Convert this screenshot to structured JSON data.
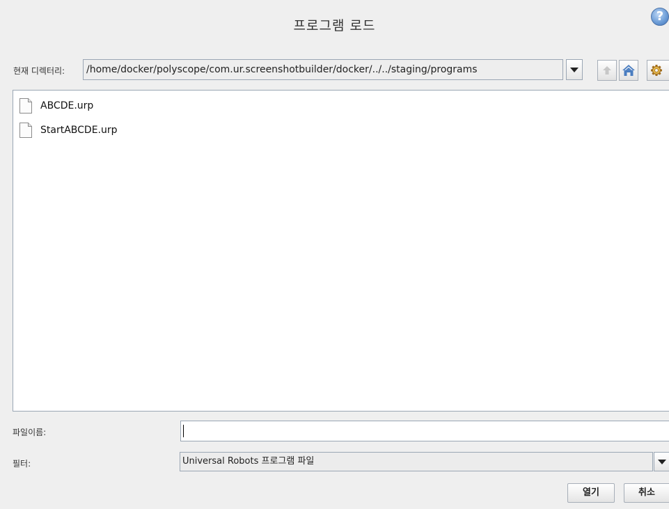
{
  "dialog": {
    "title": "프로그램 로드",
    "help_icon": "question-mark-icon"
  },
  "directory": {
    "label": "현재 디렉터리:",
    "path": "/home/docker/polyscope/com.ur.screenshotbuilder/docker/../../staging/programs",
    "toolbar_icons": [
      "up-arrow-icon",
      "home-icon",
      "gear-icon"
    ]
  },
  "files": [
    {
      "name": "ABCDE.urp",
      "icon": "file-icon"
    },
    {
      "name": "StartABCDE.urp",
      "icon": "file-icon"
    }
  ],
  "filename": {
    "label": "파일이름:",
    "value": ""
  },
  "filter": {
    "label": "필터:",
    "selected": "Universal Robots 프로그램 파일"
  },
  "buttons": {
    "open": "열기",
    "cancel": "취소"
  },
  "colors": {
    "background": "#efefef",
    "border": "#9aa6b4",
    "home_icon": "#4a7dc0"
  }
}
